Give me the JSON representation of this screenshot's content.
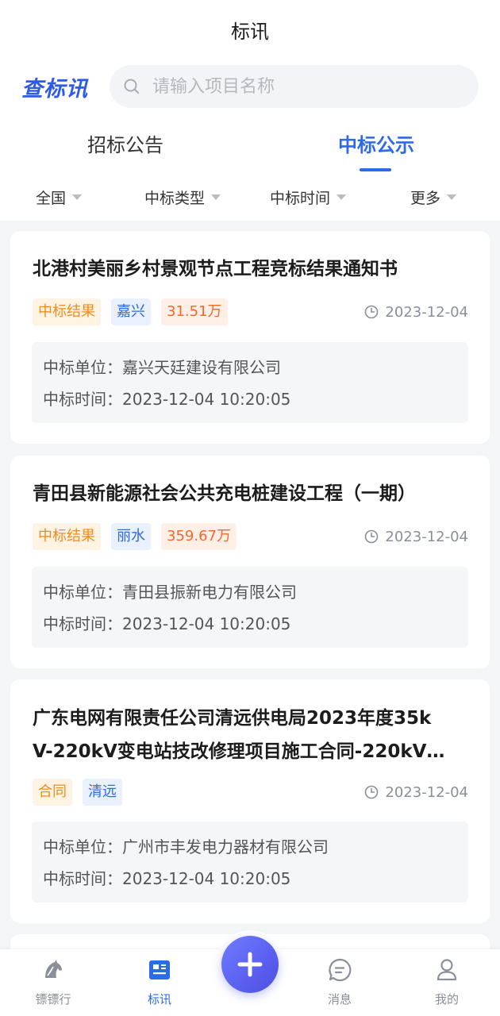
{
  "header": {
    "title": "标讯",
    "logo_text": "查标讯",
    "search_placeholder": "请输入项目名称"
  },
  "tabs": [
    {
      "label": "招标公告",
      "active": false
    },
    {
      "label": "中标公示",
      "active": true
    }
  ],
  "filters": [
    "全国",
    "中标类型",
    "中标时间",
    "更多"
  ],
  "cards": [
    {
      "title": "北港村美丽乡村景观节点工程竞标结果通知书",
      "tags": {
        "type": "中标结果",
        "region": "嘉兴",
        "amount": "31.51万"
      },
      "date": "2023-12-04",
      "winner": "中标单位：嘉兴天廷建设有限公司",
      "time": "中标时间：2023-12-04 10:20:05"
    },
    {
      "title": "青田县新能源社会公共充电桩建设工程（一期）",
      "tags": {
        "type": "中标结果",
        "region": "丽水",
        "amount": "359.67万"
      },
      "date": "2023-12-04",
      "winner": "中标单位：青田县振新电力有限公司",
      "time": "中标时间：2023-12-04 10:20:05"
    },
    {
      "title_line1": "广东电网有限责任公司清远供电局2023年度35k",
      "title_line2": "V-220kV变电站技改修理项目施工合同-220kV…",
      "tags": {
        "type": "合同",
        "region": "清远"
      },
      "date": "2023-12-04",
      "winner": "中标单位：广州市丰发电力器材有限公司",
      "time": "中标时间：2023-12-04 10:20:05"
    }
  ],
  "nav": [
    {
      "label": "镖镖行",
      "icon": "horse-icon"
    },
    {
      "label": "标讯",
      "icon": "news-icon",
      "active": true
    },
    {
      "label": "add",
      "icon": "plus-icon"
    },
    {
      "label": "消息",
      "icon": "message-icon"
    },
    {
      "label": "我的",
      "icon": "profile-icon"
    }
  ],
  "colors": {
    "accent": "#2d6ae6",
    "logo": "#2d5be3",
    "tag_result": "#f08c1d",
    "tag_region": "#2d6ae6",
    "tag_amount": "#f06a2c",
    "background": "#f4f5f7"
  }
}
